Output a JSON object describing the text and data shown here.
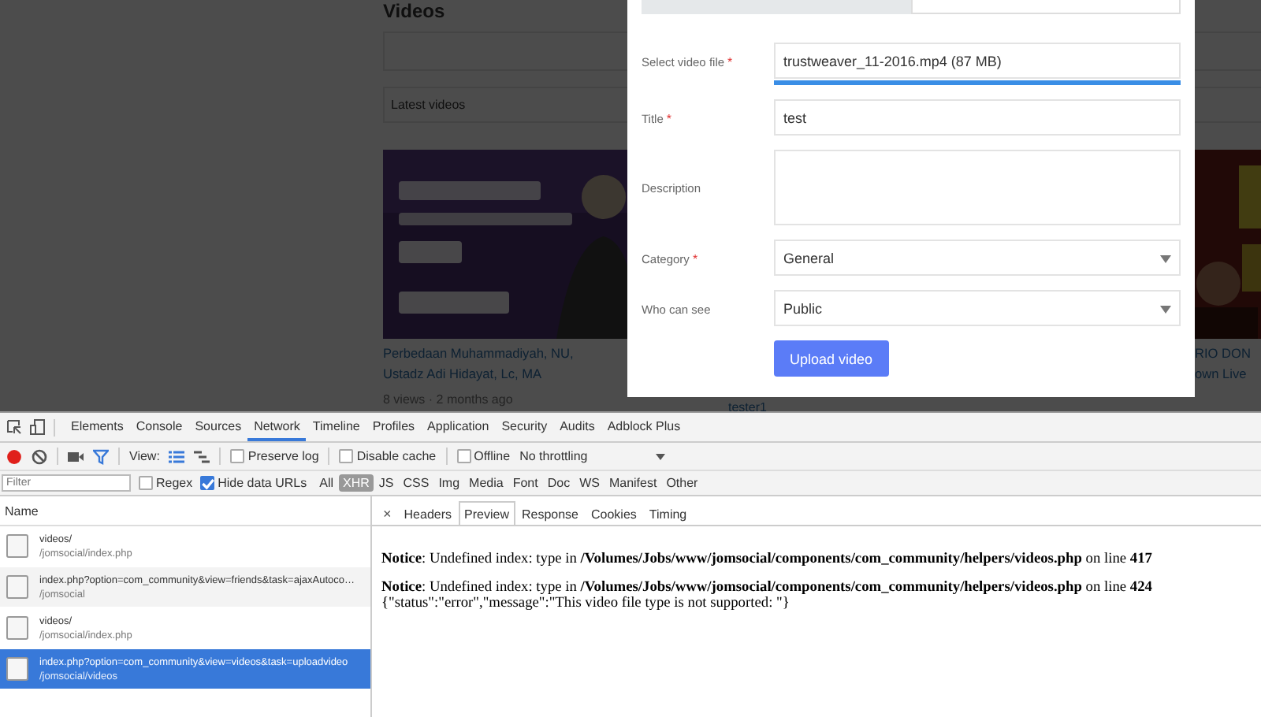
{
  "page": {
    "heading": "Videos",
    "section_title": "Latest videos",
    "videos": [
      {
        "kind": "purple",
        "title_lines": [
          "Perbedaan Muhammadiyah, NU,",
          "Ustadz Adi Hidayat, Lc, MA"
        ],
        "meta": "8 views · 2 months ago"
      },
      {
        "kind": "red",
        "title_lines": [
          "RIO DON",
          "own Live"
        ]
      }
    ],
    "author": "tester1"
  },
  "modal": {
    "required_mark": "*",
    "tabs": [
      {
        "selected": false
      },
      {
        "selected": true
      }
    ],
    "fields": [
      {
        "kind": "file",
        "label": "Select video file",
        "required": true,
        "value": "trustweaver_11-2016.mp4 (87 MB)",
        "level": 1
      },
      {
        "kind": "text",
        "label": "Title",
        "required": true,
        "value": "test"
      },
      {
        "kind": "textarea",
        "label": "Description",
        "required": false
      },
      {
        "kind": "select",
        "label": "Category",
        "required": true,
        "value": "General"
      },
      {
        "kind": "select",
        "label": "Who can see",
        "required": false,
        "value": "Public"
      }
    ],
    "button": "Upload video"
  },
  "devtools": {
    "panels": [
      {
        "label": "Elements",
        "selected": false
      },
      {
        "label": "Console",
        "selected": false
      },
      {
        "label": "Sources",
        "selected": false
      },
      {
        "label": "Network",
        "selected": true
      },
      {
        "label": "Timeline",
        "selected": false
      },
      {
        "label": "Profiles",
        "selected": false
      },
      {
        "label": "Application",
        "selected": false
      },
      {
        "label": "Security",
        "selected": false
      },
      {
        "label": "Audits",
        "selected": false
      },
      {
        "label": "Adblock Plus",
        "selected": false
      }
    ],
    "recording": true,
    "view_label": "View:",
    "options": [
      {
        "label": "Preserve log",
        "checked": false
      },
      {
        "label": "Disable cache",
        "checked": false
      },
      {
        "label": "Offline",
        "checked": false
      }
    ],
    "throttling": "No throttling",
    "filter": {
      "placeholder": "Filter"
    },
    "filter_options": [
      {
        "label": "Regex",
        "checked": false
      },
      {
        "label": "Hide data URLs",
        "checked": true
      }
    ],
    "types": [
      {
        "label": "All",
        "selected": false
      },
      {
        "label": "XHR",
        "selected": true
      },
      {
        "label": "JS",
        "selected": false
      },
      {
        "label": "CSS",
        "selected": false
      },
      {
        "label": "Img",
        "selected": false
      },
      {
        "label": "Media",
        "selected": false
      },
      {
        "label": "Font",
        "selected": false
      },
      {
        "label": "Doc",
        "selected": false
      },
      {
        "label": "WS",
        "selected": false
      },
      {
        "label": "Manifest",
        "selected": false
      },
      {
        "label": "Other",
        "selected": false
      }
    ],
    "requests": {
      "column": "Name",
      "rows": [
        {
          "name": "videos/",
          "path": "/jomsocial/index.php",
          "selected": false
        },
        {
          "name": "index.php?option=com_community&view=friends&task=ajaxAutoco…",
          "path": "/jomsocial",
          "selected": false
        },
        {
          "name": "videos/",
          "path": "/jomsocial/index.php",
          "selected": false
        },
        {
          "name": "index.php?option=com_community&view=videos&task=uploadvideo",
          "path": "/jomsocial/videos",
          "selected": true
        }
      ]
    },
    "close": "×",
    "detail_tabs": [
      {
        "label": "Headers",
        "selected": false
      },
      {
        "label": "Preview",
        "selected": true
      },
      {
        "label": "Response",
        "selected": false
      },
      {
        "label": "Cookies",
        "selected": false
      },
      {
        "label": "Timing",
        "selected": false
      }
    ],
    "preview": {
      "notices": [
        "**Notice**: Undefined index: type in **/Volumes/Jobs/www/jomsocial/components/com_community/helpers/videos.php** on line **417**",
        "**Notice**: Undefined index: type in **/Volumes/Jobs/www/jomsocial/components/com_community/helpers/videos.php** on line **424**"
      ],
      "json": "{\"status\":\"error\",\"message\":\"This video file type is not supported: \"}"
    }
  }
}
